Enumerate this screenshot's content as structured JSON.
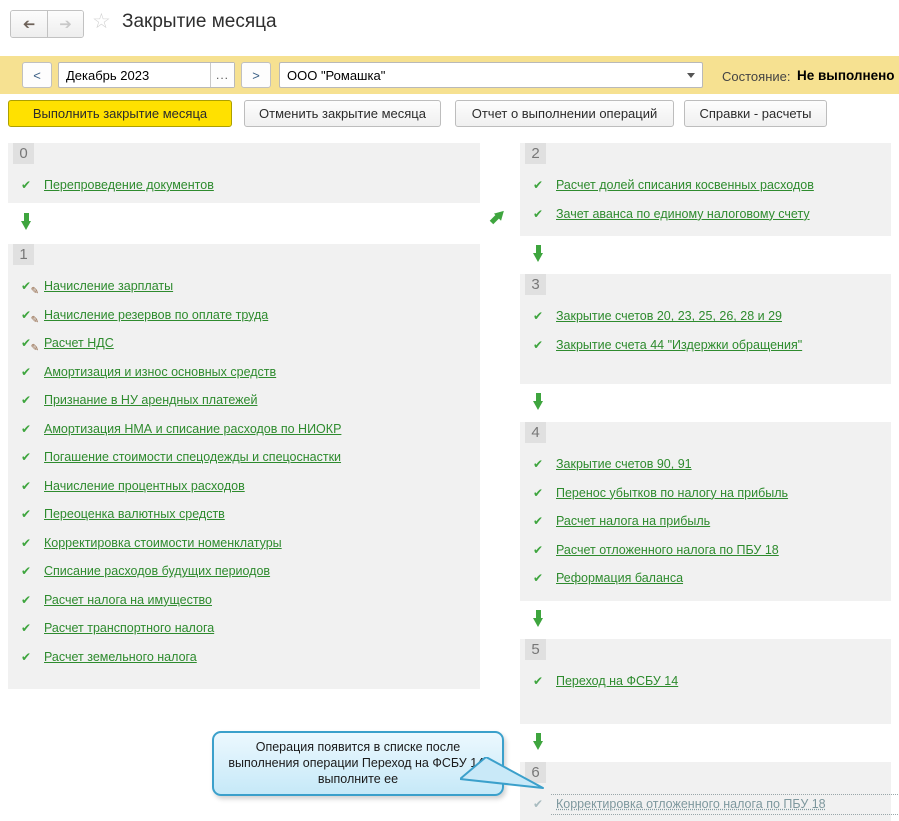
{
  "header": {
    "title": "Закрытие месяца"
  },
  "icons": {
    "nav_arrow": "➔",
    "star": "☆",
    "check": "✔",
    "pencil": "✎",
    "ellipsis": "..."
  },
  "toolbar": {
    "period": {
      "prev": "<",
      "value": "Декабрь 2023",
      "ellipsis": "...",
      "next": ">"
    },
    "organization": {
      "value": "ООО \"Ромашка\""
    },
    "status_label": "Состояние:",
    "status_value": "Не выполнено"
  },
  "actions": {
    "execute": "Выполнить закрытие месяца",
    "cancel": "Отменить закрытие месяца",
    "report": "Отчет о выполнении операций",
    "references": "Справки - расчеты"
  },
  "columns": {
    "left": [
      {
        "number": "0",
        "items": [
          {
            "label": "Перепроведение документов",
            "icon": "check"
          }
        ]
      },
      {
        "number": "1",
        "items": [
          {
            "label": "Начисление зарплаты",
            "icon": "check-edit"
          },
          {
            "label": "Начисление резервов по оплате труда",
            "icon": "check-edit"
          },
          {
            "label": "Расчет НДС",
            "icon": "check-edit"
          },
          {
            "label": "Амортизация и износ основных средств",
            "icon": "check"
          },
          {
            "label": "Признание в НУ арендных платежей",
            "icon": "check"
          },
          {
            "label": "Амортизация НМА и списание расходов по НИОКР",
            "icon": "check"
          },
          {
            "label": "Погашение стоимости спецодежды и спецоснастки",
            "icon": "check"
          },
          {
            "label": "Начисление процентных расходов",
            "icon": "check"
          },
          {
            "label": "Переоценка валютных средств",
            "icon": "check"
          },
          {
            "label": "Корректировка стоимости номенклатуры",
            "icon": "check"
          },
          {
            "label": "Списание расходов будущих периодов",
            "icon": "check"
          },
          {
            "label": "Расчет налога на имущество",
            "icon": "check"
          },
          {
            "label": "Расчет транспортного налога",
            "icon": "check"
          },
          {
            "label": "Расчет земельного налога",
            "icon": "check"
          }
        ]
      }
    ],
    "right": [
      {
        "number": "2",
        "items": [
          {
            "label": "Расчет долей списания косвенных расходов",
            "icon": "check"
          },
          {
            "label": "Зачет аванса по единому налоговому счету",
            "icon": "check"
          }
        ]
      },
      {
        "number": "3",
        "items": [
          {
            "label": "Закрытие счетов 20, 23, 25, 26, 28 и 29",
            "icon": "check"
          },
          {
            "label": "Закрытие счета 44 \"Издержки обращения\"",
            "icon": "check"
          }
        ]
      },
      {
        "number": "4",
        "items": [
          {
            "label": "Закрытие счетов 90, 91",
            "icon": "check"
          },
          {
            "label": "Перенос убытков по налогу на прибыль",
            "icon": "check"
          },
          {
            "label": "Расчет налога на прибыль",
            "icon": "check"
          },
          {
            "label": "Расчет отложенного налога по ПБУ 18",
            "icon": "check"
          },
          {
            "label": "Реформация баланса",
            "icon": "check"
          }
        ]
      },
      {
        "number": "5",
        "items": [
          {
            "label": "Переход на ФСБУ 14",
            "icon": "check"
          }
        ]
      },
      {
        "number": "6",
        "items": [
          {
            "label": "Корректировка отложенного налога по ПБУ 18",
            "icon": "check-disabled",
            "disabled": true
          }
        ]
      }
    ]
  },
  "tooltip": {
    "lines": [
      "Операция появится в списке после",
      "выполнения операции Переход на ФСБУ 14,",
      "выполните ее"
    ]
  },
  "colors": {
    "toolbar_bg": "#f6e191",
    "execute_button_bg": "#ffe100",
    "link_green": "#2e8b2e",
    "check_green": "#3ea53e",
    "section_bg": "#f1f1f1",
    "tooltip_border": "#3ba0cb",
    "tooltip_bg": "#d9f0fa",
    "disabled_link": "#7e989e"
  }
}
